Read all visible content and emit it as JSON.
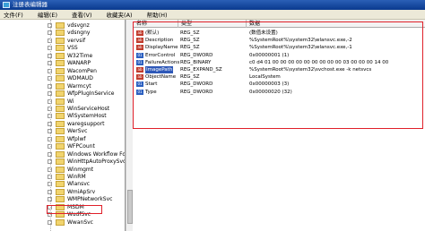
{
  "window": {
    "title": "注册表编辑器"
  },
  "menu": [
    "文件(F)",
    "编辑(E)",
    "查看(V)",
    "收藏夹(A)",
    "帮助(H)"
  ],
  "tree": {
    "items": [
      "vdsvgnz",
      "vdsngny",
      "vervsif",
      "VSS",
      "W32Time",
      "WANARP",
      "WacomPen",
      "WDMAUD",
      "Warmcyt",
      "WfpPlugInService",
      "Wi",
      "WinServiceHost",
      "WlSystemHost",
      "waregsupport",
      "WerSvc",
      "Wfplwf",
      "WFPCount",
      "Windows Workflow Fou",
      "WinHttpAutoProxySvc",
      "Winmgmt",
      "WinRM",
      "Wlansvc",
      "WmiApSrv",
      "WMPNetworkSvc",
      "MSDM",
      "WudfSvc",
      "WwanSvc"
    ]
  },
  "list": {
    "columns": {
      "name": "名称",
      "type": "类型",
      "data": "数据"
    },
    "rows": [
      {
        "icon": "string-value-icon",
        "icon_text": "ab",
        "name": "(默认)",
        "type": "REG_SZ",
        "data": "(数值未设置)"
      },
      {
        "icon": "string-value-icon",
        "icon_text": "ab",
        "name": "Description",
        "type": "REG_SZ",
        "data": "%SystemRoot%\\system32\\wlansvc.exe,-2"
      },
      {
        "icon": "string-value-icon",
        "icon_text": "ab",
        "name": "DisplayName",
        "type": "REG_SZ",
        "data": "%SystemRoot%\\system32\\wlansvc.exe,-1"
      },
      {
        "icon": "binary-value-icon",
        "icon_text": "01",
        "name": "ErrorControl",
        "type": "REG_DWORD",
        "data": "0x00000001 (1)"
      },
      {
        "icon": "binary-value-icon",
        "icon_text": "01",
        "name": "FailureActions",
        "type": "REG_BINARY",
        "data": "c0 d4 01 00 00 00 00 00 00 00 00 00 03 00 00 00 14 00"
      },
      {
        "icon": "string-value-icon",
        "icon_text": "ab",
        "name": "ImagePath",
        "type": "REG_EXPAND_SZ",
        "data": "%SystemRoot%\\system32\\svchost.exe -k netsvcs"
      },
      {
        "icon": "string-value-icon",
        "icon_text": "ab",
        "name": "ObjectName",
        "type": "REG_SZ",
        "data": "LocalSystem"
      },
      {
        "icon": "binary-value-icon",
        "icon_text": "01",
        "name": "Start",
        "type": "REG_DWORD",
        "data": "0x00000003 (3)"
      },
      {
        "icon": "binary-value-icon",
        "icon_text": "01",
        "name": "Type",
        "type": "REG_DWORD",
        "data": "0x00000020 (32)"
      }
    ]
  },
  "colors": {
    "highlight": "#2e58b8",
    "annotation_red": "#e0202a"
  }
}
